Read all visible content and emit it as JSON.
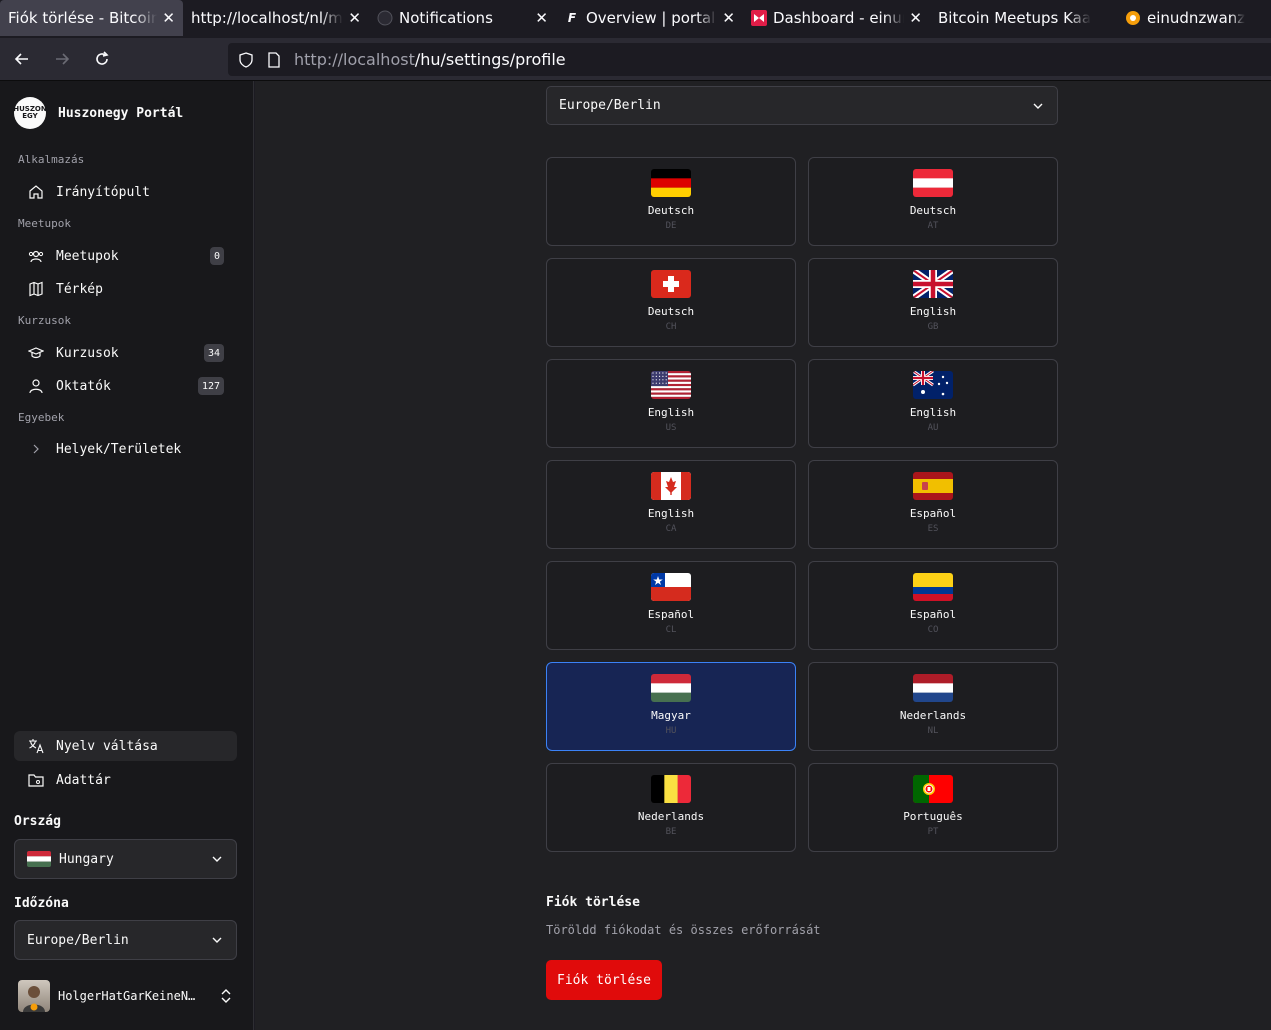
{
  "browser": {
    "tabs": [
      {
        "title": "Fiók törlése - Bitcoin Meetups",
        "active": true
      },
      {
        "title": "http://localhost/nl/map",
        "active": false
      },
      {
        "title": "Notifications",
        "active": false
      },
      {
        "title": "Overview | portal.einundzwanzig",
        "active": false
      },
      {
        "title": "Dashboard - einundzwanzig",
        "active": false
      },
      {
        "title": "Bitcoin Meetups Kaart",
        "active": false
      },
      {
        "title": "einudnzwanzig u",
        "active": false
      }
    ],
    "url_host": "http://localhost",
    "url_path": "/hu/settings/profile"
  },
  "sidebar": {
    "brand": "Huszonegy Portál",
    "logo_text": [
      "HUSZON",
      "EGY"
    ],
    "groups": {
      "app": "Alkalmazás",
      "meetups": "Meetupok",
      "courses": "Kurzusok",
      "other": "Egyebek"
    },
    "items": {
      "dashboard": "Irányítópult",
      "meetups": "Meetupok",
      "meetups_count": "0",
      "map": "Térkép",
      "courses": "Kurzusok",
      "courses_count": "34",
      "lecturers": "Oktatók",
      "lecturers_count": "127",
      "places": "Helyek/Területek"
    },
    "language_switch": "Nyelv váltása",
    "repository": "Adattár",
    "country_label": "Ország",
    "country_value": "Hungary",
    "timezone_label": "Időzóna",
    "timezone_value": "Europe/Berlin",
    "user_name": "HolgerHatGarKeineNostrPubKey"
  },
  "main": {
    "timezone_value": "Europe/Berlin",
    "languages": [
      {
        "label": "Deutsch",
        "code": "DE",
        "flag": "de",
        "selected": false
      },
      {
        "label": "Deutsch",
        "code": "AT",
        "flag": "at",
        "selected": false
      },
      {
        "label": "Deutsch",
        "code": "CH",
        "flag": "ch",
        "selected": false
      },
      {
        "label": "English",
        "code": "GB",
        "flag": "gb",
        "selected": false
      },
      {
        "label": "English",
        "code": "US",
        "flag": "us",
        "selected": false
      },
      {
        "label": "English",
        "code": "AU",
        "flag": "au",
        "selected": false
      },
      {
        "label": "English",
        "code": "CA",
        "flag": "ca",
        "selected": false
      },
      {
        "label": "Español",
        "code": "ES",
        "flag": "es",
        "selected": false
      },
      {
        "label": "Español",
        "code": "CL",
        "flag": "cl",
        "selected": false
      },
      {
        "label": "Español",
        "code": "CO",
        "flag": "co",
        "selected": false
      },
      {
        "label": "Magyar",
        "code": "HU",
        "flag": "hu",
        "selected": true
      },
      {
        "label": "Nederlands",
        "code": "NL",
        "flag": "nl",
        "selected": false
      },
      {
        "label": "Nederlands",
        "code": "BE",
        "flag": "be",
        "selected": false
      },
      {
        "label": "Português",
        "code": "PT",
        "flag": "pt",
        "selected": false
      }
    ],
    "delete_title": "Fiók törlése",
    "delete_description": "Töröldd fiókodat és összes erőforrását",
    "delete_button": "Fiók törlése"
  },
  "colors": {
    "accent": "#3b82f6",
    "danger": "#e00b0b",
    "selected_card": "#172554"
  }
}
